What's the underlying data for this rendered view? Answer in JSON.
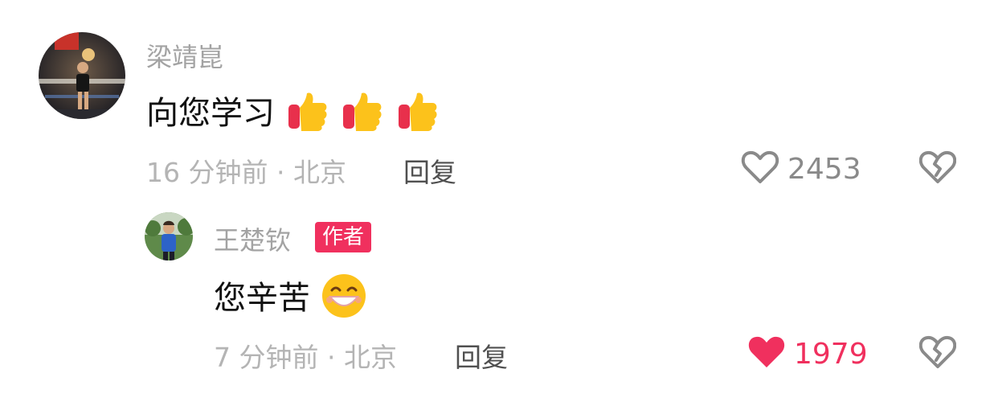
{
  "comment": {
    "author": "梁靖崑",
    "text": "向您学习",
    "emoji_icons": [
      "thumbs-up-icon",
      "thumbs-up-icon",
      "thumbs-up-icon"
    ],
    "time": "16 分钟前 · 北京",
    "reply_label": "回复",
    "like_count": "2453",
    "liked": false
  },
  "reply": {
    "author": "王楚钦",
    "author_badge": "作者",
    "text": "您辛苦",
    "emoji_icons": [
      "grinning-face-icon"
    ],
    "time": "7 分钟前 · 北京",
    "reply_label": "回复",
    "like_count": "1979",
    "liked": true
  },
  "colors": {
    "accent": "#f0305e",
    "meta": "#b4b4b4",
    "name": "#a3a3a3"
  }
}
